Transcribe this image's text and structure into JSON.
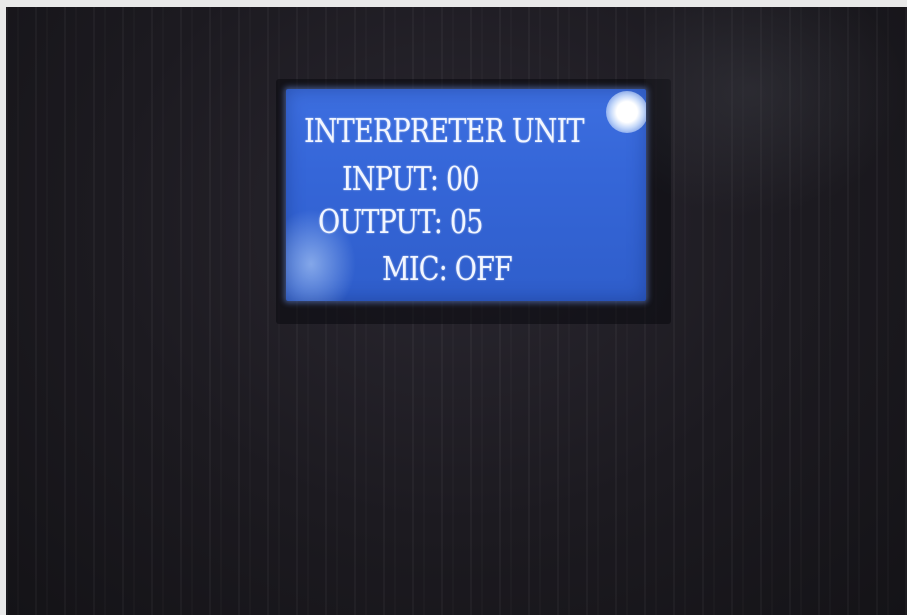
{
  "display": {
    "line1": "INTERPRETER UNIT",
    "line2": "INPUT: 00",
    "line3": "OUTPUT: 05",
    "line4": "MIC: OFF"
  },
  "colors": {
    "lcd_background": "#3566d8",
    "lcd_text": "#f2f6ff",
    "device_body": "#1c1a20"
  }
}
